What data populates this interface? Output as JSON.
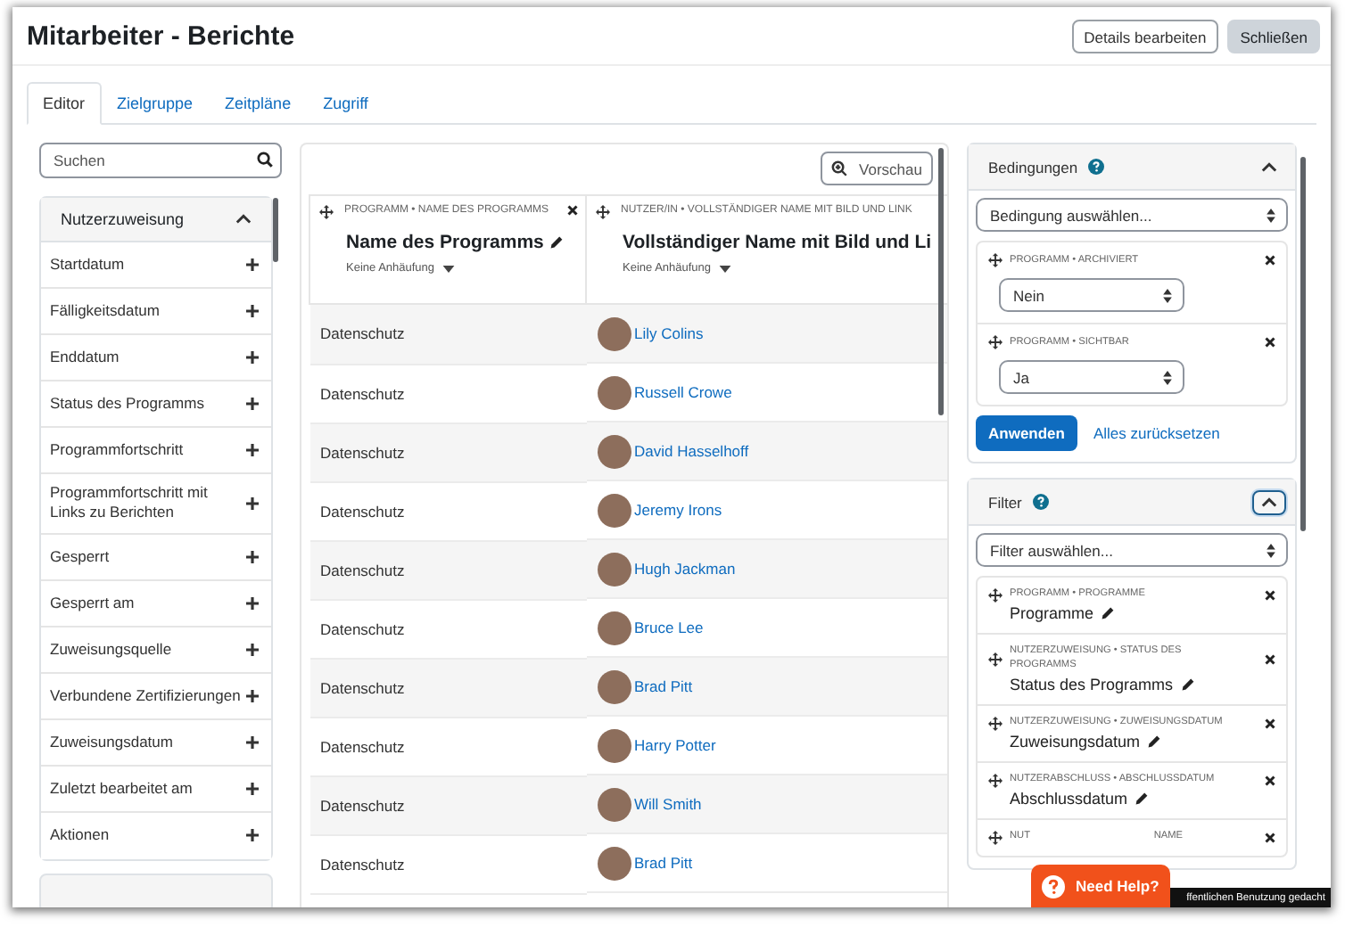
{
  "header": {
    "title": "Mitarbeiter - Berichte",
    "buttons": [
      {
        "label": "Details bearbeiten",
        "kind": "outline"
      },
      {
        "label": "Schließen",
        "kind": "secondary"
      }
    ]
  },
  "tabs": [
    {
      "label": "Editor",
      "selected": true
    },
    {
      "label": "Zielgruppe",
      "selected": false
    },
    {
      "label": "Zeitpläne",
      "selected": false
    },
    {
      "label": "Zugriff",
      "selected": false
    }
  ],
  "sidebar": {
    "search": {
      "placeholder": "Suchen"
    },
    "section": {
      "title": "Nutzerzuweisung",
      "expanded": true,
      "items": [
        {
          "label": "Startdatum"
        },
        {
          "label": "Fälligkeitsdatum"
        },
        {
          "label": "Enddatum"
        },
        {
          "label": "Status des Programms"
        },
        {
          "label": "Programmfortschritt"
        },
        {
          "label": "Programmfortschritt mit Links zu Berichten"
        },
        {
          "label": "Gesperrt"
        },
        {
          "label": "Gesperrt am"
        },
        {
          "label": "Zuweisungsquelle"
        },
        {
          "label": "Verbundene Zertifizierungen"
        },
        {
          "label": "Zuweisungsdatum"
        },
        {
          "label": "Zuletzt bearbeitet am"
        },
        {
          "label": "Aktionen"
        }
      ]
    }
  },
  "report": {
    "preview_button": "Vorschau",
    "columns": [
      {
        "category": "PROGRAMM • NAME DES PROGRAMMS",
        "title": "Name des Programms",
        "aggregation": "Keine Anhäufung",
        "removable": true,
        "editable": true
      },
      {
        "category": "NUTZER/IN • VOLLSTÄNDIGER NAME MIT BILD UND LINK",
        "title": "Vollständiger Name mit Bild und Li",
        "aggregation": "Keine Anhäufung",
        "removable": false,
        "editable": false
      }
    ],
    "rows": [
      {
        "program": "Datenschutz",
        "user": "Lily Colins"
      },
      {
        "program": "Datenschutz",
        "user": "Russell Crowe"
      },
      {
        "program": "Datenschutz",
        "user": "David Hasselhoff"
      },
      {
        "program": "Datenschutz",
        "user": "Jeremy Irons"
      },
      {
        "program": "Datenschutz",
        "user": "Hugh Jackman"
      },
      {
        "program": "Datenschutz",
        "user": "Bruce Lee"
      },
      {
        "program": "Datenschutz",
        "user": "Brad Pitt"
      },
      {
        "program": "Datenschutz",
        "user": "Harry Potter"
      },
      {
        "program": "Datenschutz",
        "user": "Will Smith"
      },
      {
        "program": "Datenschutz",
        "user": "Brad Pitt"
      }
    ]
  },
  "conditions": {
    "title": "Bedingungen",
    "expanded": true,
    "focused": false,
    "select_placeholder": "Bedingung auswählen...",
    "items": [
      {
        "label": "PROGRAMM • ARCHIVIERT",
        "value": "Nein"
      },
      {
        "label": "PROGRAMM • SICHTBAR",
        "value": "Ja"
      }
    ],
    "apply": "Anwenden",
    "reset": "Alles zurücksetzen"
  },
  "filters": {
    "title": "Filter",
    "expanded": true,
    "focused": true,
    "select_placeholder": "Filter auswählen...",
    "items": [
      {
        "label": "PROGRAMM • PROGRAMME",
        "value": "Programme"
      },
      {
        "label": "NUTZERZUWEISUNG • STATUS DES PROGRAMMS",
        "value": "Status des Programms"
      },
      {
        "label": "NUTZERZUWEISUNG • ZUWEISUNGSDATUM",
        "value": "Zuweisungsdatum"
      },
      {
        "label": "NUTZERABSCHLUSS • ABSCHLUSSDATUM",
        "value": "Abschlussdatum"
      },
      {
        "label": "NUT",
        "label_end": "NAME"
      }
    ]
  },
  "help_button": "Need Help?",
  "notice": "ffentlichen Benutzung gedacht"
}
